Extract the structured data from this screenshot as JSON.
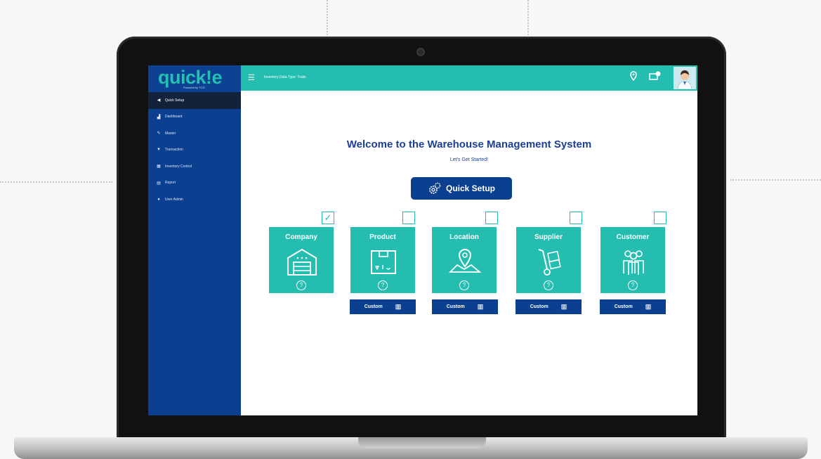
{
  "app": {
    "logo_text": "quick!e",
    "logo_sub": "Powered by TCG",
    "top_label": "Inventory Data Type: Traits"
  },
  "sidebar": {
    "items": [
      {
        "label": "Quick Setup",
        "icon": "back-arrow-icon"
      },
      {
        "label": "Dashboard",
        "icon": "dashboard-icon"
      },
      {
        "label": "Master",
        "icon": "master-icon"
      },
      {
        "label": "Transaction",
        "icon": "transaction-icon"
      },
      {
        "label": "Inventory Control",
        "icon": "inventory-icon"
      },
      {
        "label": "Report",
        "icon": "report-icon"
      },
      {
        "label": "User Admin",
        "icon": "user-admin-icon"
      }
    ]
  },
  "main": {
    "welcome_title": "Welcome to the Warehouse Management System",
    "subtitle": "Let's Get Started!",
    "quick_setup_label": "Quick Setup",
    "cards": [
      {
        "title": "Company",
        "checked": true,
        "has_custom": false
      },
      {
        "title": "Product",
        "checked": false,
        "has_custom": true
      },
      {
        "title": "Location",
        "checked": false,
        "has_custom": true
      },
      {
        "title": "Supplier",
        "checked": false,
        "has_custom": true
      },
      {
        "title": "Customer",
        "checked": false,
        "has_custom": true
      }
    ],
    "custom_label": "Custom",
    "info_glyph": "?",
    "check_glyph": "✓"
  },
  "colors": {
    "teal": "#24bdb0",
    "navy": "#0b3f8f"
  }
}
